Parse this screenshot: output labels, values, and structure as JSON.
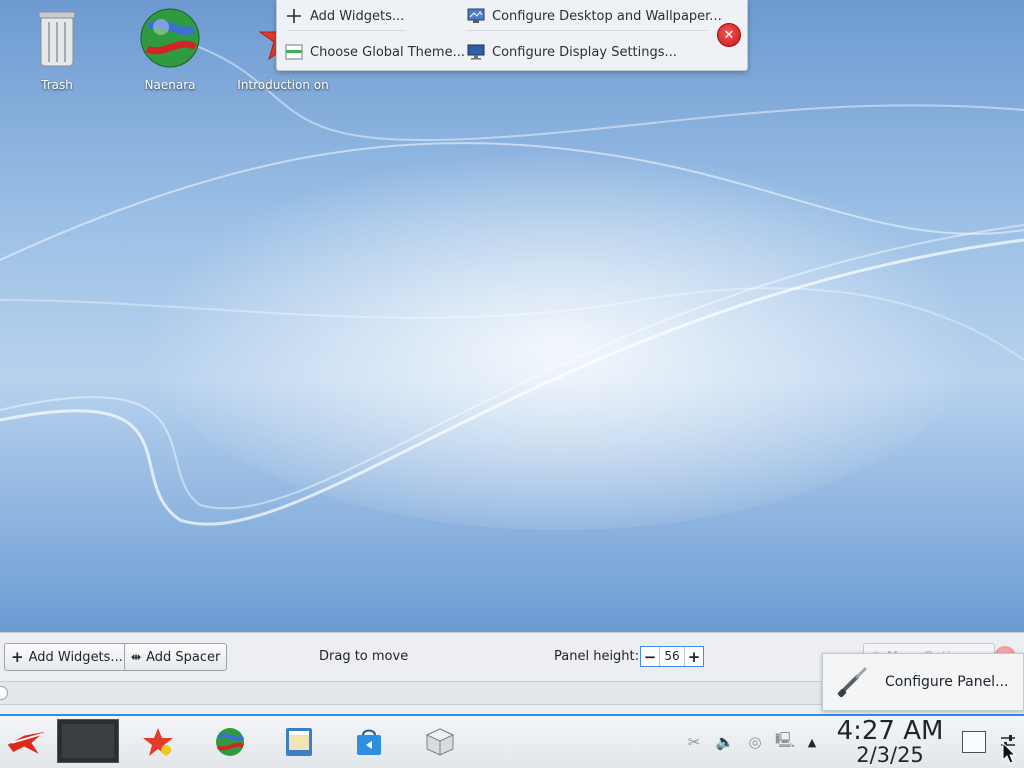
{
  "desktop": {
    "icons": [
      {
        "label": "Trash",
        "icon": "trash-icon"
      },
      {
        "label": "Naenara",
        "icon": "globe-browser-icon"
      },
      {
        "label": "Introduction on",
        "icon": "red-star-icon"
      }
    ]
  },
  "toolbox": {
    "add_widgets": "Add Widgets...",
    "configure_desktop": "Configure Desktop and Wallpaper...",
    "choose_theme": "Choose Global Theme...",
    "configure_display": "Configure Display Settings..."
  },
  "panel_editor": {
    "add_widgets": "Add Widgets...",
    "add_spacer": "Add Spacer",
    "drag_hint": "Drag to move",
    "height_label": "Panel height:",
    "height_value": "56",
    "more_options": "More Options...",
    "configure_panel": "Configure Panel..."
  },
  "taskbar": {
    "launchers": [
      "red-star-menu-icon",
      "pager",
      "red-star-app-icon",
      "globe-browser-icon",
      "file-manager-icon",
      "store-bag-icon",
      "package-box-icon"
    ],
    "tray": [
      "scissors-icon",
      "volume-icon",
      "network-globe-icon",
      "computer-icon",
      "expand-arrow-icon"
    ],
    "clock_time": "4:27 AM",
    "clock_date": "2/3/25"
  },
  "colors": {
    "accent": "#2d8ce8",
    "close_red": "#d21919",
    "panel_bg": "#eceef1"
  }
}
